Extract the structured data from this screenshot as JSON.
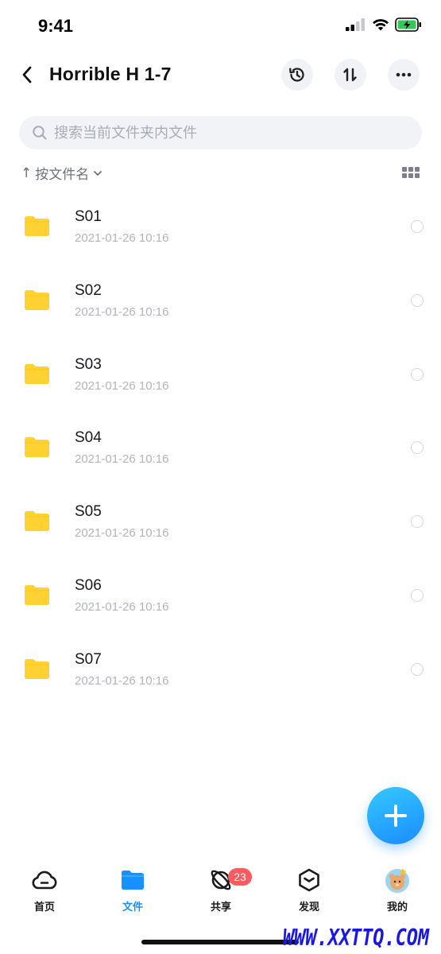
{
  "status_bar": {
    "time": "9:41"
  },
  "header": {
    "title": "Horrible H 1-7"
  },
  "search": {
    "placeholder": "搜索当前文件夹内文件"
  },
  "sort": {
    "arrow": "↑",
    "label": "按文件名"
  },
  "folders": [
    {
      "name": "S01",
      "date": "2021-01-26 10:16"
    },
    {
      "name": "S02",
      "date": "2021-01-26 10:16"
    },
    {
      "name": "S03",
      "date": "2021-01-26 10:16"
    },
    {
      "name": "S04",
      "date": "2021-01-26 10:16"
    },
    {
      "name": "S05",
      "date": "2021-01-26 10:16"
    },
    {
      "name": "S06",
      "date": "2021-01-26 10:16"
    },
    {
      "name": "S07",
      "date": "2021-01-26 10:16"
    }
  ],
  "tabs": [
    {
      "label": "首页",
      "icon": "cloud-icon"
    },
    {
      "label": "文件",
      "icon": "folder-icon",
      "active": true
    },
    {
      "label": "共享",
      "icon": "orbit-icon",
      "badge": "23"
    },
    {
      "label": "发现",
      "icon": "cube-icon"
    },
    {
      "label": "我的",
      "icon": "avatar-icon"
    }
  ],
  "colors": {
    "accent": "#1592ff",
    "folder": "#ffd233",
    "badge": "#ff5a5f",
    "watermark": "#1a18e0"
  },
  "watermark": "WWW.XXTTQ.COM"
}
